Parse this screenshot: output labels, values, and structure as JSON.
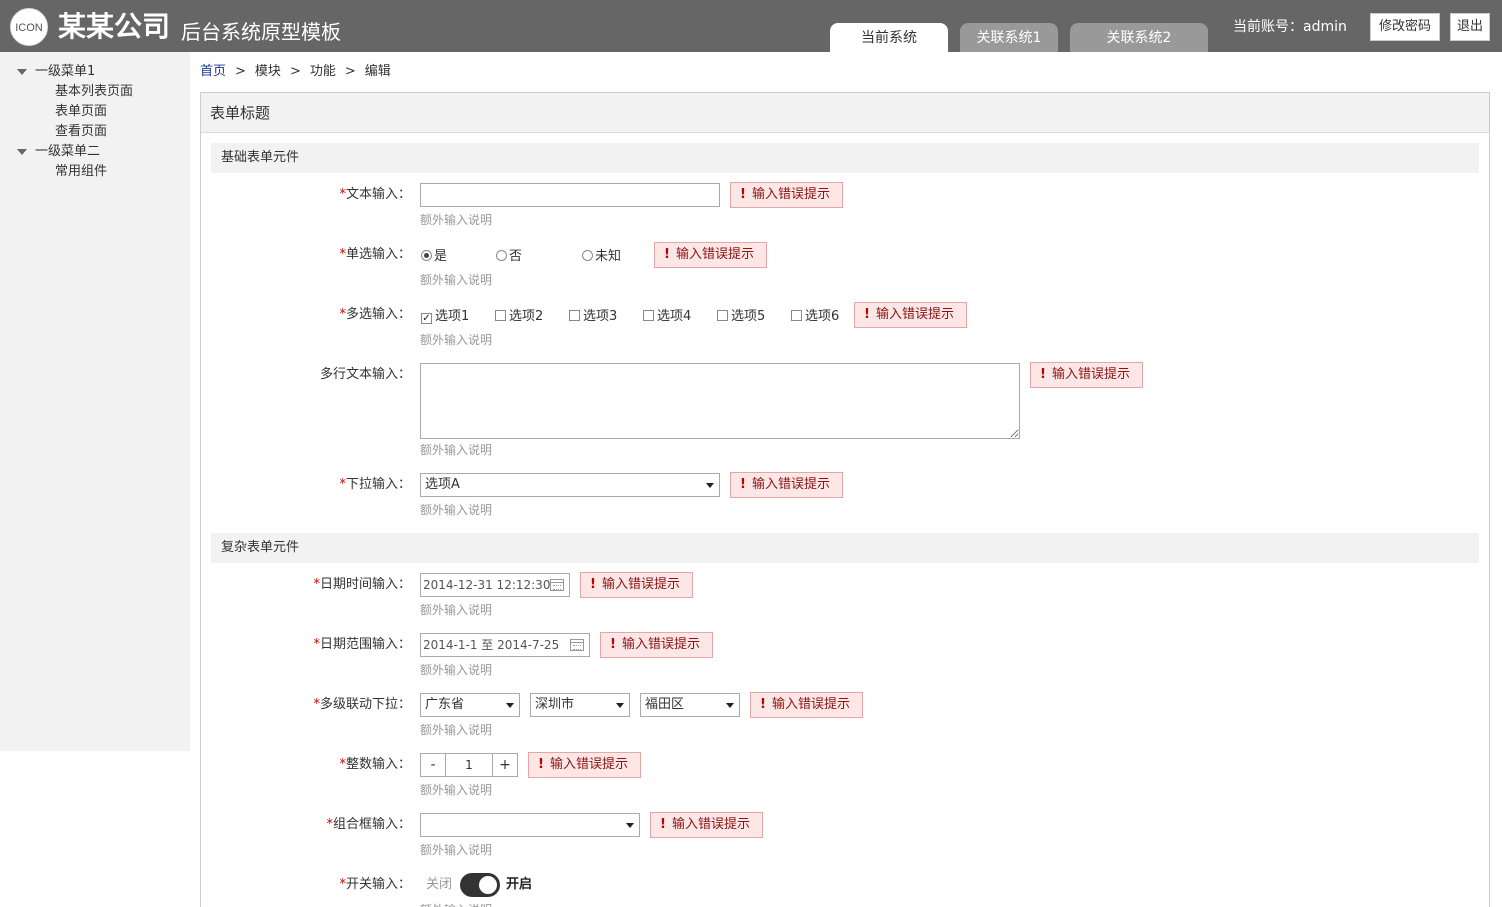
{
  "header": {
    "logo_text": "ICON",
    "company": "某某公司",
    "system_name": "后台系统原型模板",
    "tabs": [
      {
        "label": "当前系统",
        "active": true
      },
      {
        "label": "关联系统1",
        "active": false
      },
      {
        "label": "关联系统2",
        "active": false
      }
    ],
    "account_label": "当前账号：admin",
    "change_password": "修改密码",
    "logout": "退出",
    "colors": {
      "bar": "#666666",
      "tab_inactive": "#999999"
    }
  },
  "sidebar": {
    "groups": [
      {
        "label": "一级菜单1",
        "items": [
          "基本列表页面",
          "表单页面",
          "查看页面"
        ]
      },
      {
        "label": "一级菜单二",
        "items": [
          "常用组件"
        ]
      }
    ]
  },
  "breadcrumb": {
    "items": [
      "首页",
      "模块",
      "功能",
      "编辑"
    ],
    "separator": ">"
  },
  "form": {
    "title": "表单标题",
    "hint": "额外输入说明",
    "error": "输入错误提示",
    "required_mark": "*",
    "label_suffix": "：",
    "sections": [
      "基础表单元件",
      "复杂表单元件"
    ],
    "text_input": {
      "label": "文本输入",
      "value": ""
    },
    "radio_input": {
      "label": "单选输入",
      "options": [
        "是",
        "否",
        "未知"
      ],
      "selected": "是"
    },
    "checkbox_input": {
      "label": "多选输入",
      "options": [
        "选项1",
        "选项2",
        "选项3",
        "选项4",
        "选项5",
        "选项6"
      ],
      "checked": [
        "选项1"
      ]
    },
    "textarea_input": {
      "label": "多行文本输入",
      "value": ""
    },
    "select_input": {
      "label": "下拉输入",
      "value": "选项A"
    },
    "datetime_input": {
      "label": "日期时间输入",
      "value": "2014-12-31 12:12:30"
    },
    "daterange_input": {
      "label": "日期范围输入",
      "value": "2014-1-1 至 2014-7-25"
    },
    "cascade_input": {
      "label": "多级联动下拉",
      "province": "广东省",
      "city": "深圳市",
      "district": "福田区"
    },
    "integer_input": {
      "label": "整数输入",
      "minus": "-",
      "value": "1",
      "plus": "+"
    },
    "combo_input": {
      "label": "组合框输入",
      "value": ""
    },
    "switch_input": {
      "label": "开关输入",
      "off_label": "关闭",
      "on_label": "开启",
      "on": true
    },
    "colors": {
      "error_bg": "#fde6e6",
      "error_text": "#8a1414",
      "required": "#cc0000"
    }
  }
}
